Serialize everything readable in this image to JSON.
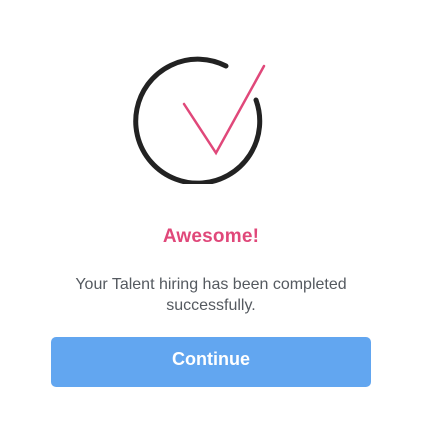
{
  "dialog": {
    "title": "Awesome!",
    "message": "Your Talent hiring has been completed successfully.",
    "continue_label": "Continue",
    "icon": "check-circle-icon"
  },
  "colors": {
    "accent_pink": "#e0487a",
    "ring": "#222222",
    "button_blue": "#62a6f0",
    "text_gray": "#555a60"
  }
}
